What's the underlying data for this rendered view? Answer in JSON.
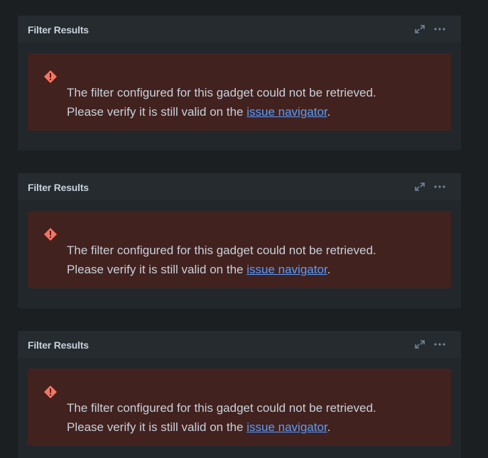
{
  "gadgets": [
    {
      "title": "Filter Results",
      "icons": {
        "expand": "expand-icon",
        "more": "more-icon",
        "error": "error-icon"
      },
      "error": {
        "line1": "The filter configured for this gadget could not be retrieved.",
        "line2_prefix": "Please verify it is still valid on the ",
        "link": "issue navigator",
        "line2_suffix": "."
      }
    },
    {
      "title": "Filter Results",
      "icons": {
        "expand": "expand-icon",
        "more": "more-icon",
        "error": "error-icon"
      },
      "error": {
        "line1": "The filter configured for this gadget could not be retrieved.",
        "line2_prefix": "Please verify it is still valid on the ",
        "link": "issue navigator",
        "line2_suffix": "."
      }
    },
    {
      "title": "Filter Results",
      "icons": {
        "expand": "expand-icon",
        "more": "more-icon",
        "error": "error-icon"
      },
      "error": {
        "line1": "The filter configured for this gadget could not be retrieved.",
        "line2_prefix": "Please verify it is still valid on the ",
        "link": "issue navigator",
        "line2_suffix": "."
      }
    }
  ],
  "colors": {
    "background": "#1c1f22",
    "panel": "#22272b",
    "error_background": "#42221f",
    "error_icon": "#f87462",
    "link": "#579dff",
    "text": "#c7d1db"
  }
}
